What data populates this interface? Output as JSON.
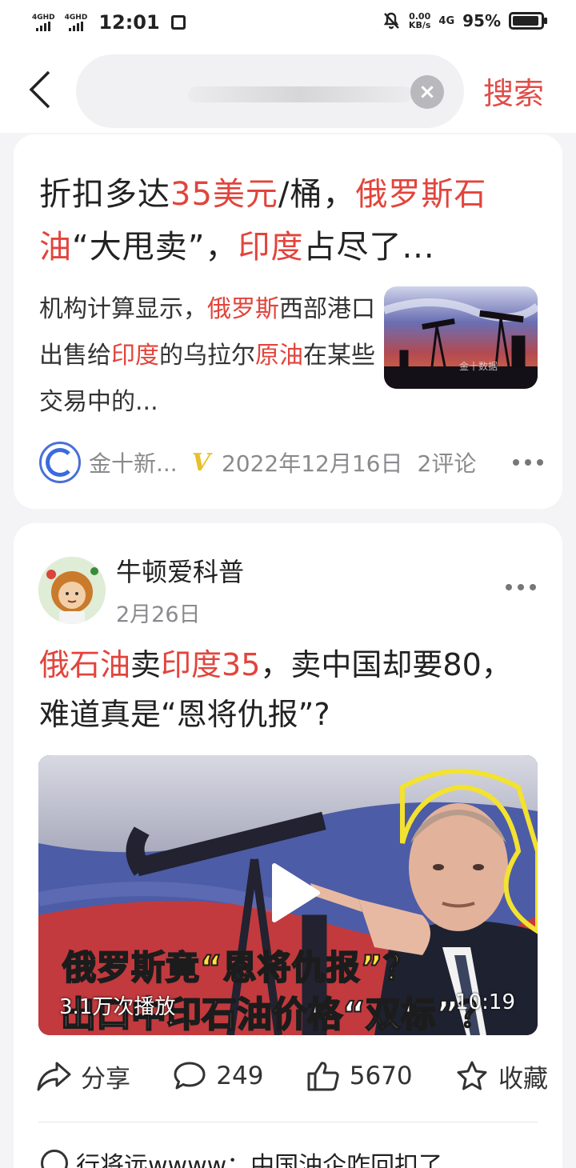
{
  "status_bar": {
    "network1": "4GHD",
    "network2": "4GHD",
    "time": "12:01",
    "speed_value": "0.00",
    "speed_unit": "KB/s",
    "network3": "4G",
    "battery": "95%",
    "battery_level": 0.95
  },
  "search": {
    "button_label": "搜索",
    "clear_label": "×",
    "placeholder": ""
  },
  "article": {
    "title_parts": [
      "折扣多达",
      "35美元",
      "/桶，",
      "俄罗斯",
      "石油",
      "“大甩卖”，",
      "印度",
      "占尽了..."
    ],
    "desc_parts": [
      "机构计算显示，",
      "俄罗斯",
      "西部港口出售给",
      "印度",
      "的乌拉尔",
      "原油",
      "在某些交易中的..."
    ],
    "thumb_watermark": "金十数据",
    "source": "金十新...",
    "verified_mark": "V",
    "date": "2022年12月16日",
    "comments": "2评论"
  },
  "post": {
    "author": "牛顿爱科普",
    "date": "2月26日",
    "title_parts": [
      "俄石油",
      "卖",
      "印度35",
      "，卖中国却要80，难道真是“恩将仇报”?"
    ],
    "video": {
      "caption_line1": "俄罗斯竟“恩将仇报”？",
      "caption_line2": "出口中印石油价格“双标”？",
      "views": "3.1万次播放",
      "duration": "10:19"
    },
    "actions": {
      "share": "分享",
      "comments": "249",
      "likes": "5670",
      "favorite": "收藏"
    },
    "comment_preview": "行将远wwww：中国油企咋回扣了"
  },
  "colors": {
    "highlight": "#e2443c",
    "search_button": "#e14c47",
    "verified": "#e7c02a"
  }
}
